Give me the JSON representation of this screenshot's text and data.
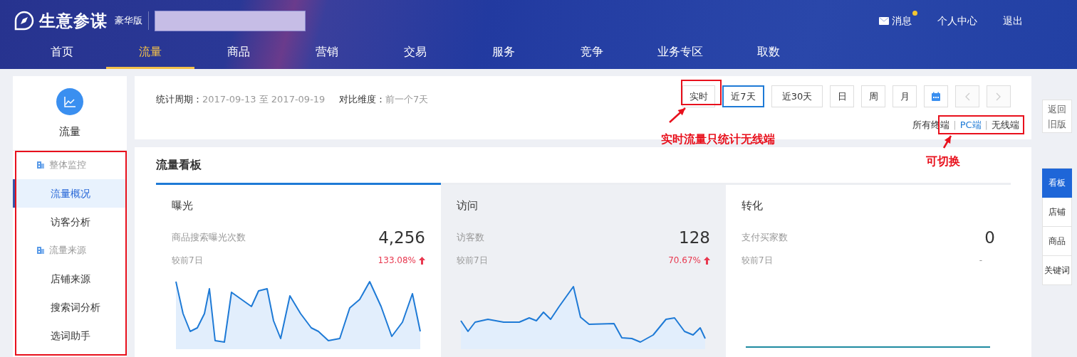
{
  "header": {
    "brand": "生意参谋",
    "edition": "豪华版",
    "links": [
      {
        "label": "消息",
        "kind": "messages",
        "unread": true
      },
      {
        "label": "个人中心",
        "kind": "text"
      },
      {
        "label": "退出",
        "kind": "text"
      }
    ]
  },
  "nav": [
    {
      "label": "首页",
      "selected": false
    },
    {
      "label": "流量",
      "selected": true
    },
    {
      "label": "商品",
      "selected": false
    },
    {
      "label": "营销",
      "selected": false
    },
    {
      "label": "交易",
      "selected": false
    },
    {
      "label": "服务",
      "selected": false
    },
    {
      "label": "竞争",
      "selected": false
    },
    {
      "label": "业务专区",
      "selected": false
    },
    {
      "label": "取数",
      "selected": false
    }
  ],
  "sidebar": {
    "title": "流量",
    "items": [
      {
        "label": "整体监控",
        "kind": "group",
        "selected": false
      },
      {
        "label": "流量概况",
        "kind": "link",
        "selected": true
      },
      {
        "label": "访客分析",
        "kind": "link",
        "selected": false
      },
      {
        "label": "流量来源",
        "kind": "group",
        "selected": false
      },
      {
        "label": "店铺来源",
        "kind": "link",
        "selected": false
      },
      {
        "label": "搜索词分析",
        "kind": "link",
        "selected": false
      },
      {
        "label": "选词助手",
        "kind": "link",
        "selected": false
      }
    ]
  },
  "filter": {
    "period_label": "统计周期：",
    "period": "2017-09-13 至 2017-09-19",
    "compare_label": "对比维度：",
    "compare": "前一个7天",
    "ranges": [
      {
        "kind": "text",
        "label": "实时",
        "selected": false,
        "disabled": false
      },
      {
        "kind": "text",
        "label": "近7天",
        "selected": true,
        "disabled": false
      },
      {
        "kind": "text",
        "label": "近30天",
        "selected": false,
        "disabled": false
      },
      {
        "kind": "text",
        "label": "日",
        "selected": false,
        "disabled": false
      },
      {
        "kind": "text",
        "label": "周",
        "selected": false,
        "disabled": false
      },
      {
        "kind": "text",
        "label": "月",
        "selected": false,
        "disabled": false
      },
      {
        "kind": "calendar",
        "selected": false,
        "disabled": false
      },
      {
        "kind": "prev",
        "selected": false,
        "disabled": true
      },
      {
        "kind": "next",
        "selected": false,
        "disabled": true
      }
    ],
    "separator": "|",
    "terminals": [
      {
        "label": "所有终端",
        "selected": false
      },
      {
        "label": "PC端",
        "selected": true
      },
      {
        "label": "无线端",
        "selected": false
      }
    ]
  },
  "board": {
    "title": "流量看板",
    "metrics": [
      {
        "title": "曝光",
        "name": "商品搜索曝光次数",
        "value": "4,256",
        "compare_label": "较前7日",
        "change": "133.08%",
        "up_arrow": true,
        "selected": true,
        "highlighted": false
      },
      {
        "title": "访问",
        "name": "访客数",
        "value": "128",
        "compare_label": "较前7日",
        "change": "70.67%",
        "up_arrow": true,
        "selected": false,
        "highlighted": true
      },
      {
        "title": "转化",
        "name": "支付买家数",
        "value": "0",
        "compare_label": "较前7日",
        "change": "-",
        "up_arrow": false,
        "selected": false,
        "highlighted": false
      }
    ]
  },
  "right_rail": {
    "back": "返回旧版",
    "tabs": [
      {
        "label": "看板",
        "selected": true
      },
      {
        "label": "店铺",
        "selected": false
      },
      {
        "label": "商品",
        "selected": false
      },
      {
        "label": "关键词",
        "selected": false
      }
    ]
  },
  "annotations": [
    {
      "kind": "realtime-note",
      "text": "实时流量只统计无线端"
    },
    {
      "kind": "switch-note",
      "text": "可切换"
    }
  ]
}
